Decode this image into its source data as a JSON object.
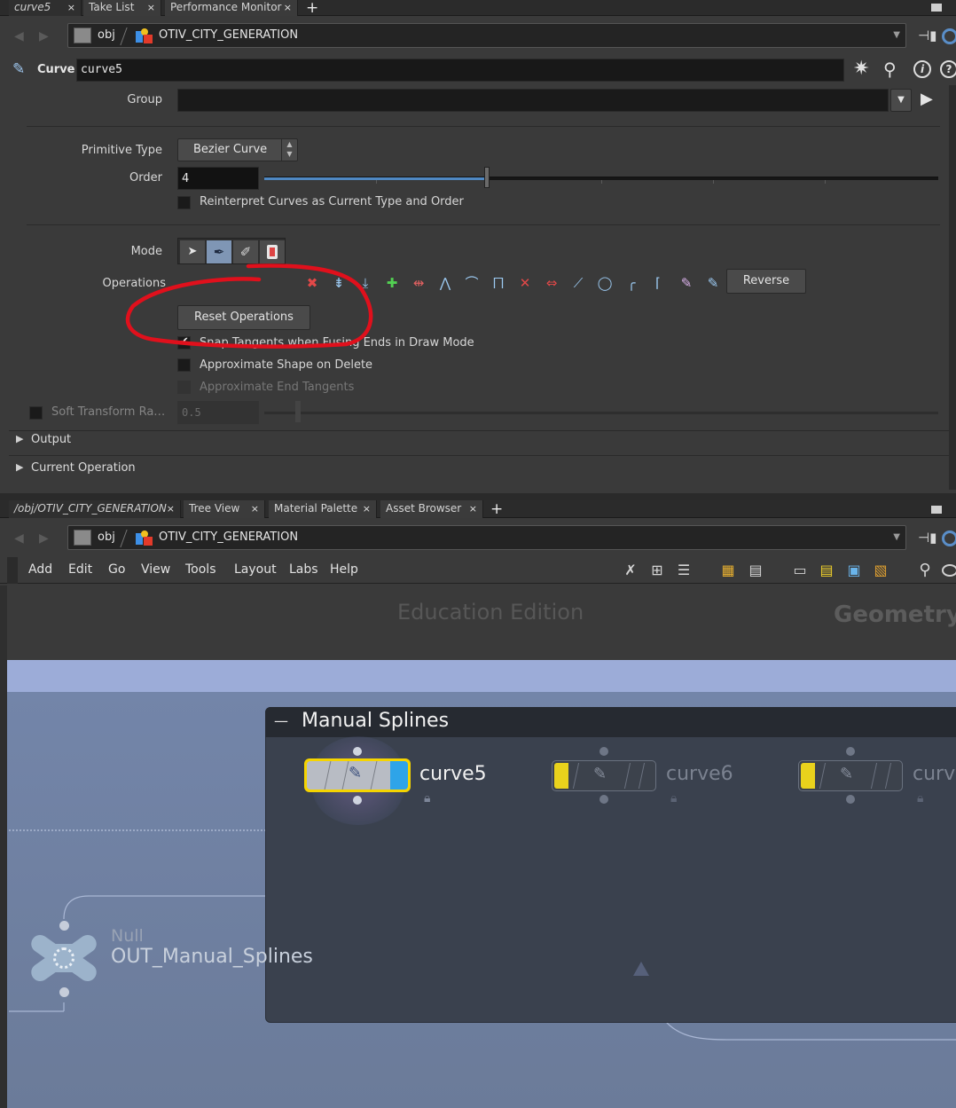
{
  "top_tabs": {
    "tab1": "curve5",
    "tab2": "Take List",
    "tab3": "Performance Monitor",
    "close": "×",
    "add": "+"
  },
  "path_top": {
    "seg1": "obj",
    "seg2": "OTIV_CITY_GENERATION"
  },
  "node_header": {
    "type": "Curve",
    "name": "curve5"
  },
  "params": {
    "group_label": "Group",
    "group_value": "",
    "primitive_type_label": "Primitive Type",
    "primitive_type_value": "Bezier Curve",
    "order_label": "Order",
    "order_value": "4",
    "order_slider_fraction": 0.33,
    "reinterpret_label": "Reinterpret Curves as Current Type and Order",
    "mode_label": "Mode",
    "operations_label": "Operations",
    "reverse_label": "Reverse",
    "reset_label": "Reset Operations",
    "snap_label": "Snap Tangents when Fusing Ends in Draw Mode",
    "approx_shape_label": "Approximate Shape on Delete",
    "approx_tan_label": "Approximate End Tangents",
    "soft_label": "Soft Transform Ra…",
    "soft_value": "0.5",
    "output_label": "Output",
    "current_op_label": "Current Operation"
  },
  "bottom_tabs": {
    "tab1": "/obj/OTIV_CITY_GENERATION",
    "tab2": "Tree View",
    "tab3": "Material Palette",
    "tab4": "Asset Browser"
  },
  "path_bottom": {
    "seg1": "obj",
    "seg2": "OTIV_CITY_GENERATION"
  },
  "menu": [
    "Add",
    "Edit",
    "Go",
    "View",
    "Tools",
    "Layout",
    "Labs",
    "Help"
  ],
  "network": {
    "watermark_edition": "Education Edition",
    "watermark_context": "Geometry",
    "netbox_title": "Manual Splines",
    "netbox_collapse": "—",
    "node1": "curve5",
    "node2": "curve6",
    "node3": "curv",
    "null_type": "Null",
    "null_name": "OUT_Manual_Splines"
  },
  "colors": {
    "annotation_red": "#e0101c",
    "network_bg": "#6e7e9e",
    "netbox_bg": "#3a414e",
    "selected_node_outline": "#f5d400",
    "node_flag_yellow": "#e9d21c",
    "node_flag_blue": "#2ea4e8"
  }
}
